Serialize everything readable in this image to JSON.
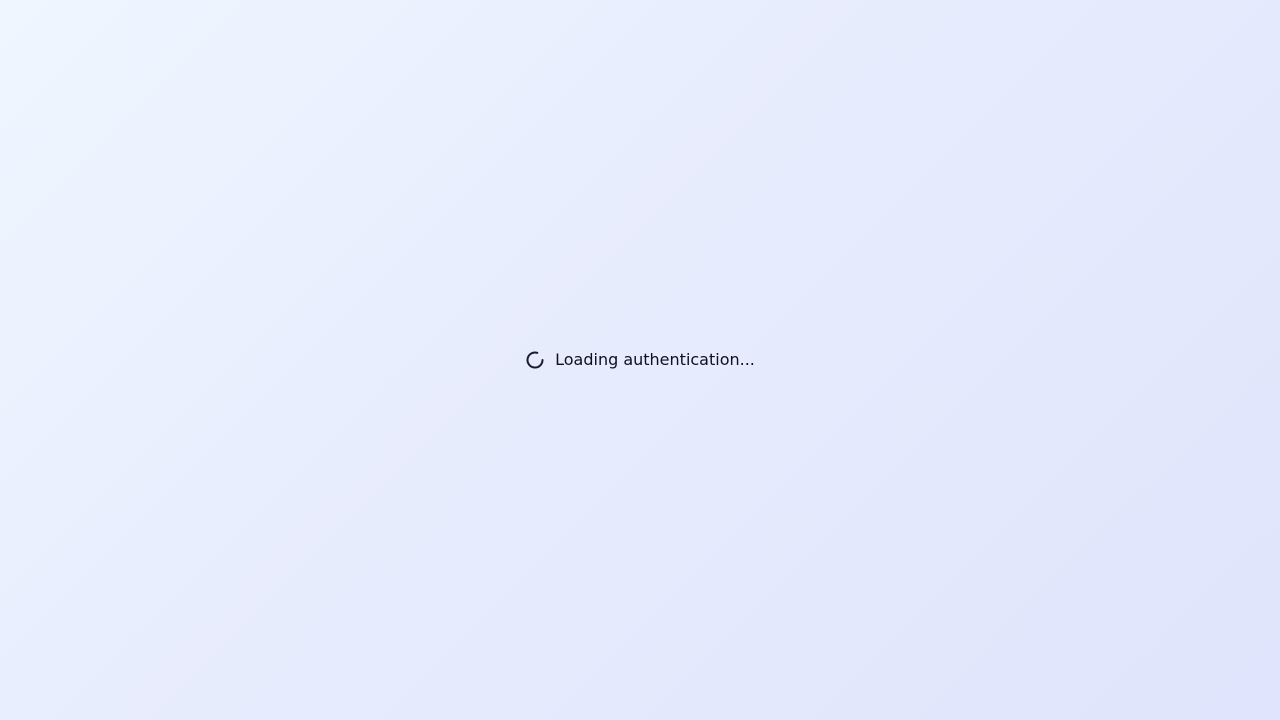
{
  "status": {
    "message": "Loading authentication...",
    "icon": "spinner-icon"
  },
  "colors": {
    "text": "#0f0f1e",
    "spinner": "#1a1a2e",
    "background_start": "#eff6ff",
    "background_end": "#e0e4fc"
  }
}
